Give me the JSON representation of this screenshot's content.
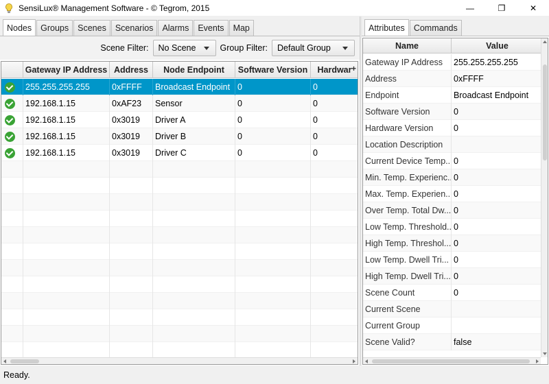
{
  "window": {
    "title": "SensiLux® Management Software - © Tegrom, 2015",
    "minimize_glyph": "—",
    "maximize_glyph": "❐",
    "close_glyph": "✕"
  },
  "left_tabs": [
    "Nodes",
    "Groups",
    "Scenes",
    "Scenarios",
    "Alarms",
    "Events",
    "Map"
  ],
  "filters": {
    "scene_label": "Scene Filter:",
    "scene_value": "No Scene",
    "group_label": "Group Filter:",
    "group_value": "Default Group"
  },
  "nodes_table": {
    "columns": [
      "",
      "Gateway IP Address",
      "Address",
      "Node Endpoint",
      "Software Version",
      "Hardwar"
    ],
    "column_menu_glyph": "+",
    "rows": [
      {
        "ip": "255.255.255.255",
        "address": "0xFFFF",
        "endpoint": "Broadcast Endpoint",
        "sw": "0",
        "hw": "0",
        "selected": true
      },
      {
        "ip": "192.168.1.15",
        "address": "0xAF23",
        "endpoint": "Sensor",
        "sw": "0",
        "hw": "0"
      },
      {
        "ip": "192.168.1.15",
        "address": "0x3019",
        "endpoint": "Driver A",
        "sw": "0",
        "hw": "0"
      },
      {
        "ip": "192.168.1.15",
        "address": "0x3019",
        "endpoint": "Driver B",
        "sw": "0",
        "hw": "0"
      },
      {
        "ip": "192.168.1.15",
        "address": "0x3019",
        "endpoint": "Driver C",
        "sw": "0",
        "hw": "0"
      }
    ],
    "empty_rows": 12
  },
  "right_tabs": [
    "Attributes",
    "Commands"
  ],
  "attributes_table": {
    "columns": [
      "Name",
      "Value"
    ],
    "rows": [
      {
        "name": "Gateway IP Address",
        "value": "255.255.255.255"
      },
      {
        "name": "Address",
        "value": "0xFFFF"
      },
      {
        "name": "Endpoint",
        "value": "Broadcast Endpoint"
      },
      {
        "name": "Software Version",
        "value": "0"
      },
      {
        "name": "Hardware Version",
        "value": "0"
      },
      {
        "name": "Location Description",
        "value": ""
      },
      {
        "name": "Current Device Temp...",
        "value": "0"
      },
      {
        "name": "Min. Temp. Experienc...",
        "value": "0"
      },
      {
        "name": "Max. Temp. Experien...",
        "value": "0"
      },
      {
        "name": "Over Temp. Total Dw...",
        "value": "0"
      },
      {
        "name": "Low Temp. Threshold...",
        "value": "0"
      },
      {
        "name": "High Temp. Threshol...",
        "value": "0"
      },
      {
        "name": "Low Temp. Dwell Tri...",
        "value": "0"
      },
      {
        "name": "High Temp. Dwell Tri...",
        "value": "0"
      },
      {
        "name": "Scene Count",
        "value": "0"
      },
      {
        "name": "Current Scene",
        "value": ""
      },
      {
        "name": "Current Group",
        "value": ""
      },
      {
        "name": "Scene Valid?",
        "value": "false"
      }
    ]
  },
  "status": {
    "text": "Ready."
  }
}
